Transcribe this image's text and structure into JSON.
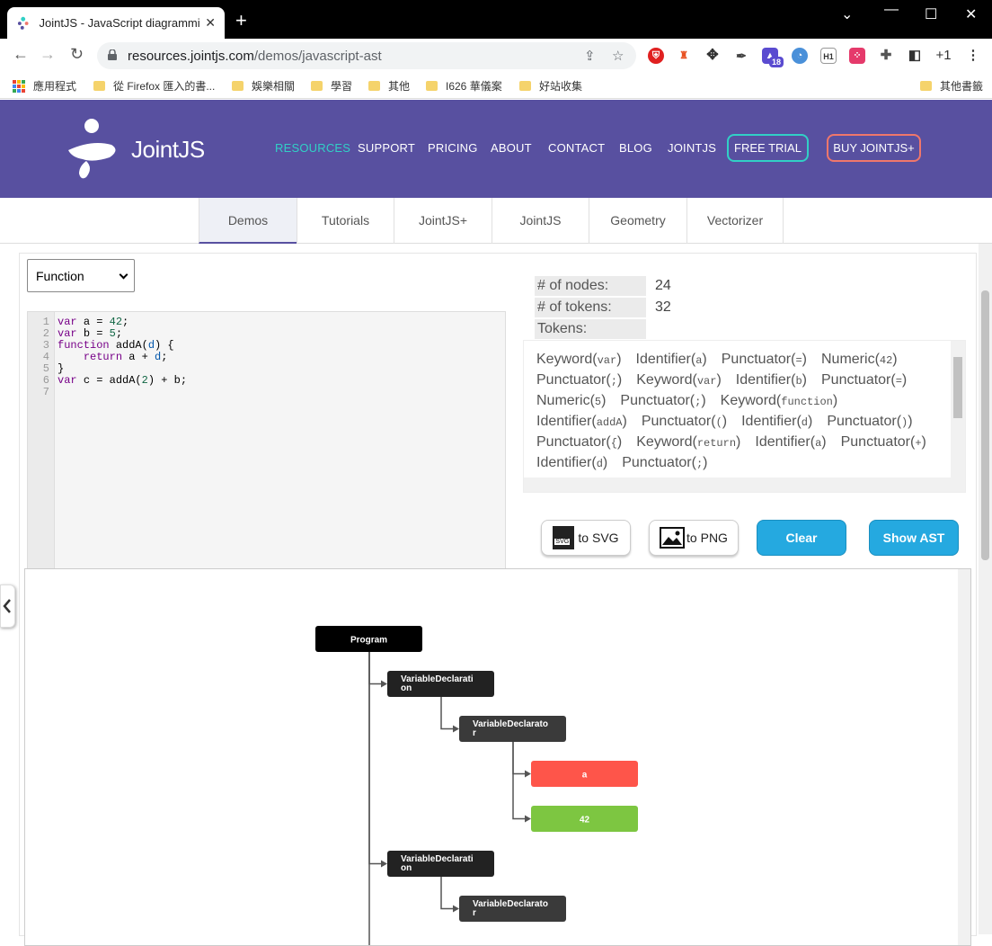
{
  "browser": {
    "tab_title": "JointJS - JavaScript diagrammir",
    "url_host": "resources.jointjs.com",
    "url_path": "/demos/javascript-ast",
    "ext_badge": "18",
    "profile_label": "+1"
  },
  "bookmarks": [
    {
      "label": "應用程式"
    },
    {
      "label": "從 Firefox 匯入的書..."
    },
    {
      "label": "娛樂相關"
    },
    {
      "label": "學習"
    },
    {
      "label": "其他"
    },
    {
      "label": "I626 華儀案"
    },
    {
      "label": "好站收集"
    },
    {
      "label": "其他書籤"
    }
  ],
  "site": {
    "logo_text": "JointJS",
    "nav": [
      "RESOURCES",
      "SUPPORT",
      "PRICING",
      "ABOUT",
      "CONTACT",
      "BLOG",
      "JOINTJS"
    ],
    "free_trial": "FREE TRIAL",
    "buy": "BUY JOINTJS+",
    "brand_color": "#5850a0",
    "accent_color": "#31d0c6"
  },
  "subtabs": [
    "Demos",
    "Tutorials",
    "JointJS+",
    "JointJS",
    "Geometry",
    "Vectorizer"
  ],
  "demo": {
    "select_value": "Function",
    "code_lines": [
      "var a = 42;",
      "var b = 5;",
      "function addA(d) {",
      "    return a + d;",
      "}",
      "var c = addA(2) + b;",
      ""
    ],
    "stats": {
      "nodes_label": "# of nodes:",
      "nodes_value": "24",
      "tokens_label": "# of tokens:",
      "tokens_value": "32",
      "tokens_header": "Tokens:"
    },
    "tokens": [
      {
        "type": "Keyword",
        "value": "var"
      },
      {
        "type": "Identifier",
        "value": "a"
      },
      {
        "type": "Punctuator",
        "value": "="
      },
      {
        "type": "Numeric",
        "value": "42"
      },
      {
        "type": "Punctuator",
        "value": ";"
      },
      {
        "type": "Keyword",
        "value": "var"
      },
      {
        "type": "Identifier",
        "value": "b"
      },
      {
        "type": "Punctuator",
        "value": "="
      },
      {
        "type": "Numeric",
        "value": "5"
      },
      {
        "type": "Punctuator",
        "value": ";"
      },
      {
        "type": "Keyword",
        "value": "function"
      },
      {
        "type": "Identifier",
        "value": "addA"
      },
      {
        "type": "Punctuator",
        "value": "("
      },
      {
        "type": "Identifier",
        "value": "d"
      },
      {
        "type": "Punctuator",
        "value": ")"
      },
      {
        "type": "Punctuator",
        "value": "{"
      },
      {
        "type": "Keyword",
        "value": "return"
      },
      {
        "type": "Identifier",
        "value": "a"
      },
      {
        "type": "Punctuator",
        "value": "+"
      },
      {
        "type": "Identifier",
        "value": "d"
      },
      {
        "type": "Punctuator",
        "value": ";"
      }
    ],
    "buttons": {
      "svg": "to SVG",
      "svg_badge": "SVG",
      "png": "to PNG",
      "clear": "Clear",
      "show_ast": "Show AST"
    },
    "ast_nodes": [
      {
        "label": "Program",
        "color": "#000000"
      },
      {
        "label": "VariableDeclaration",
        "color": "#222222"
      },
      {
        "label": "VariableDeclarator",
        "color": "#3a3a3a"
      },
      {
        "label": "a",
        "color": "#fe554a"
      },
      {
        "label": "42",
        "color": "#7dc641"
      },
      {
        "label": "VariableDeclaration",
        "color": "#222222"
      },
      {
        "label": "VariableDeclarator",
        "color": "#3a3a3a"
      }
    ]
  }
}
